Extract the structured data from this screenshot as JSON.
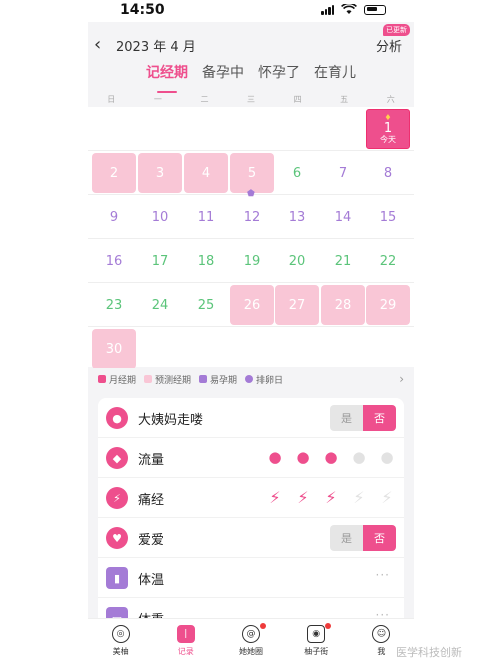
{
  "status": {
    "time": "14:50"
  },
  "header": {
    "month": "2023 年 4 月",
    "analyze": "分析",
    "badge": "已更新"
  },
  "tabs": [
    {
      "label": "记经期",
      "active": true
    },
    {
      "label": "备孕中",
      "active": false
    },
    {
      "label": "怀孕了",
      "active": false
    },
    {
      "label": "在育儿",
      "active": false
    }
  ],
  "weekdays": [
    "日",
    "一",
    "二",
    "三",
    "四",
    "五",
    "六"
  ],
  "calendar": {
    "today": {
      "day": "1",
      "label": "今天"
    },
    "rows": [
      [
        {
          "d": "2",
          "t": "period"
        },
        {
          "d": "3",
          "t": "period"
        },
        {
          "d": "4",
          "t": "period"
        },
        {
          "d": "5",
          "t": "period"
        },
        {
          "d": "6",
          "t": "green"
        },
        {
          "d": "7",
          "t": "purple"
        },
        {
          "d": "8",
          "t": "purple"
        }
      ],
      [
        {
          "d": "9",
          "t": "purple"
        },
        {
          "d": "10",
          "t": "purple"
        },
        {
          "d": "11",
          "t": "purple"
        },
        {
          "d": "12",
          "t": "purple"
        },
        {
          "d": "13",
          "t": "purple"
        },
        {
          "d": "14",
          "t": "purple"
        },
        {
          "d": "15",
          "t": "purple"
        }
      ],
      [
        {
          "d": "16",
          "t": "purple"
        },
        {
          "d": "17",
          "t": "green"
        },
        {
          "d": "18",
          "t": "green"
        },
        {
          "d": "19",
          "t": "green"
        },
        {
          "d": "20",
          "t": "green"
        },
        {
          "d": "21",
          "t": "green"
        },
        {
          "d": "22",
          "t": "green"
        }
      ],
      [
        {
          "d": "23",
          "t": "green"
        },
        {
          "d": "24",
          "t": "green"
        },
        {
          "d": "25",
          "t": "green"
        },
        {
          "d": "26",
          "t": "period"
        },
        {
          "d": "27",
          "t": "period"
        },
        {
          "d": "28",
          "t": "period"
        },
        {
          "d": "29",
          "t": "period"
        }
      ],
      [
        {
          "d": "30",
          "t": "period"
        }
      ]
    ]
  },
  "legend": [
    {
      "label": "月经期",
      "color": "#ee4f8d"
    },
    {
      "label": "预测经期",
      "color": "#f9c6d6"
    },
    {
      "label": "易孕期",
      "color": "#a47bd6"
    },
    {
      "label": "排卵日",
      "color": "#a47bd6"
    }
  ],
  "records": {
    "period_coming": {
      "label": "大姨妈走喽",
      "yes": "是",
      "no": "否"
    },
    "flow": {
      "label": "流量",
      "level": 3,
      "max": 5
    },
    "cramps": {
      "label": "痛经",
      "level": 3,
      "max": 5
    },
    "love": {
      "label": "爱爱",
      "yes": "是",
      "no": "否"
    },
    "temperature": {
      "label": "体温",
      "more": "···"
    },
    "weight": {
      "label": "体重",
      "more": "···"
    }
  },
  "tabbar": [
    {
      "label": "美柚",
      "icon": "home-icon",
      "active": false,
      "dot": false
    },
    {
      "label": "记录",
      "icon": "record-icon",
      "active": true,
      "dot": false
    },
    {
      "label": "她她圈",
      "icon": "community-icon",
      "active": false,
      "dot": true
    },
    {
      "label": "柚子街",
      "icon": "shop-icon",
      "active": false,
      "dot": true
    },
    {
      "label": "我",
      "icon": "profile-icon",
      "active": false,
      "dot": false
    }
  ],
  "watermark": "医学科技创新"
}
